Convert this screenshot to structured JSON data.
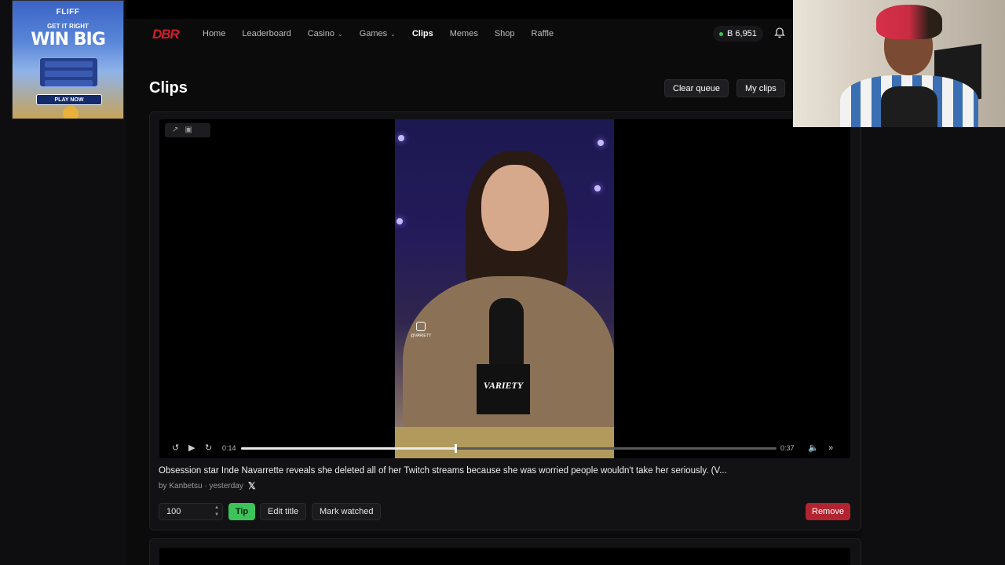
{
  "ad": {
    "brand": "FLIFF",
    "tagline": "GET IT RIGHT",
    "headline": "WIN BIG",
    "cta": "PLAY NOW"
  },
  "header": {
    "logo": "DBR",
    "nav": [
      {
        "label": "Home",
        "has_menu": false,
        "active": false
      },
      {
        "label": "Leaderboard",
        "has_menu": false,
        "active": false
      },
      {
        "label": "Casino",
        "has_menu": true,
        "active": false
      },
      {
        "label": "Games",
        "has_menu": true,
        "active": false
      },
      {
        "label": "Clips",
        "has_menu": false,
        "active": true
      },
      {
        "label": "Memes",
        "has_menu": false,
        "active": false
      },
      {
        "label": "Shop",
        "has_menu": false,
        "active": false
      },
      {
        "label": "Raffle",
        "has_menu": false,
        "active": false
      }
    ],
    "balance": "B 6,951",
    "balance_status_color": "#3ec25a",
    "notification_icon": "bell-icon"
  },
  "page": {
    "title": "Clips",
    "clear_queue_label": "Clear queue",
    "my_clips_label": "My clips"
  },
  "clip": {
    "frame_watermark": "@VARIETY",
    "mic_brand": "VARIETY",
    "player": {
      "current_time": "0:14",
      "duration": "0:37",
      "progress": 0.4
    },
    "title": "Obsession star Inde Navarrette reveals she deleted all of her Twitch streams because she was worried people wouldn't take her seriously. (V...",
    "meta": "by Kanbetsu · yesterday",
    "source_icon": "x-logo-icon",
    "amount_value": "100",
    "tip_label": "Tip",
    "edit_title_label": "Edit title",
    "mark_watched_label": "Mark watched",
    "remove_label": "Remove"
  },
  "colors": {
    "accent_green": "#3ec25a",
    "danger_red": "#b32431",
    "logo_red": "#d11e2a"
  }
}
